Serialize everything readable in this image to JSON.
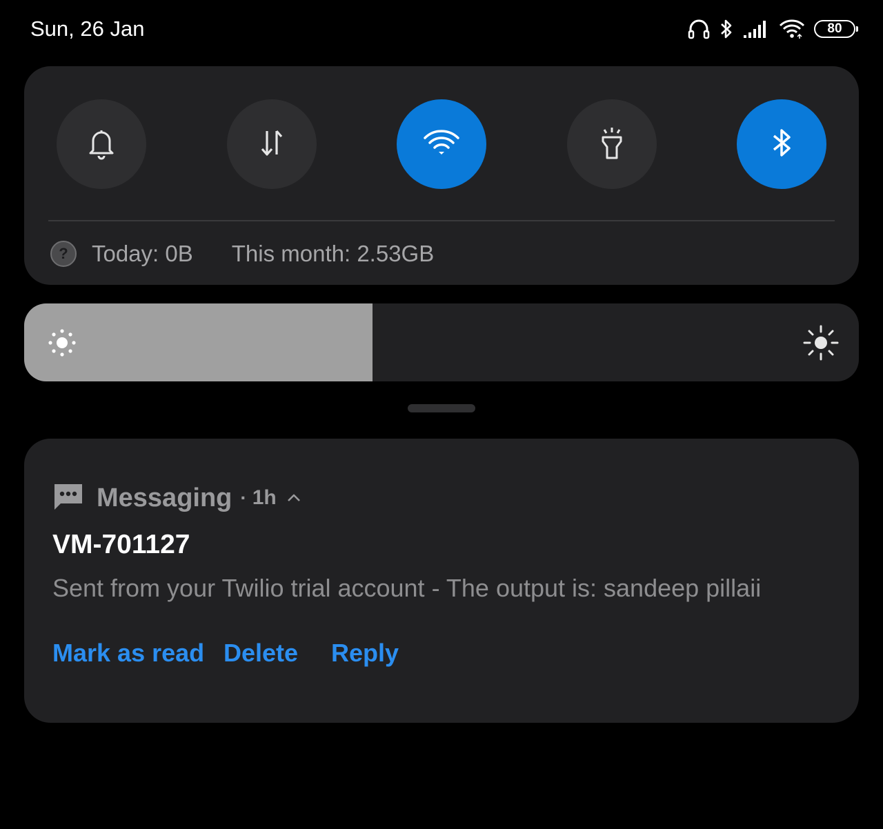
{
  "status_bar": {
    "date": "Sun, 26 Jan",
    "battery_level": "80",
    "icons": [
      "headphones-icon",
      "bluetooth-icon",
      "signal-icon",
      "wifi-icon",
      "battery-icon"
    ]
  },
  "quick_settings": {
    "toggles": [
      {
        "name": "silent",
        "icon": "bell-icon",
        "active": false
      },
      {
        "name": "mobile-data",
        "icon": "data-arrows-icon",
        "active": false
      },
      {
        "name": "wifi",
        "icon": "wifi-icon",
        "active": true
      },
      {
        "name": "flashlight",
        "icon": "flashlight-icon",
        "active": false
      },
      {
        "name": "bluetooth",
        "icon": "bluetooth-icon",
        "active": true
      }
    ],
    "data_usage": {
      "today": "Today: 0B",
      "month": "This month: 2.53GB"
    }
  },
  "brightness": {
    "level": 0.417
  },
  "notification": {
    "app_name": "Messaging",
    "separator": "·",
    "time": "1h",
    "sender": "VM-701127",
    "message": "Sent from your Twilio trial account - The output is: sandeep pillaii",
    "actions": {
      "mark_read": "Mark as read",
      "delete": "Delete",
      "reply": "Reply"
    }
  },
  "colors": {
    "background": "#000000",
    "panel": "#212123",
    "toggle_inactive": "#2e2e30",
    "toggle_active": "#0a7ad9",
    "action_link": "#2b8ef0",
    "brightness_fill": "#a0a0a0"
  }
}
